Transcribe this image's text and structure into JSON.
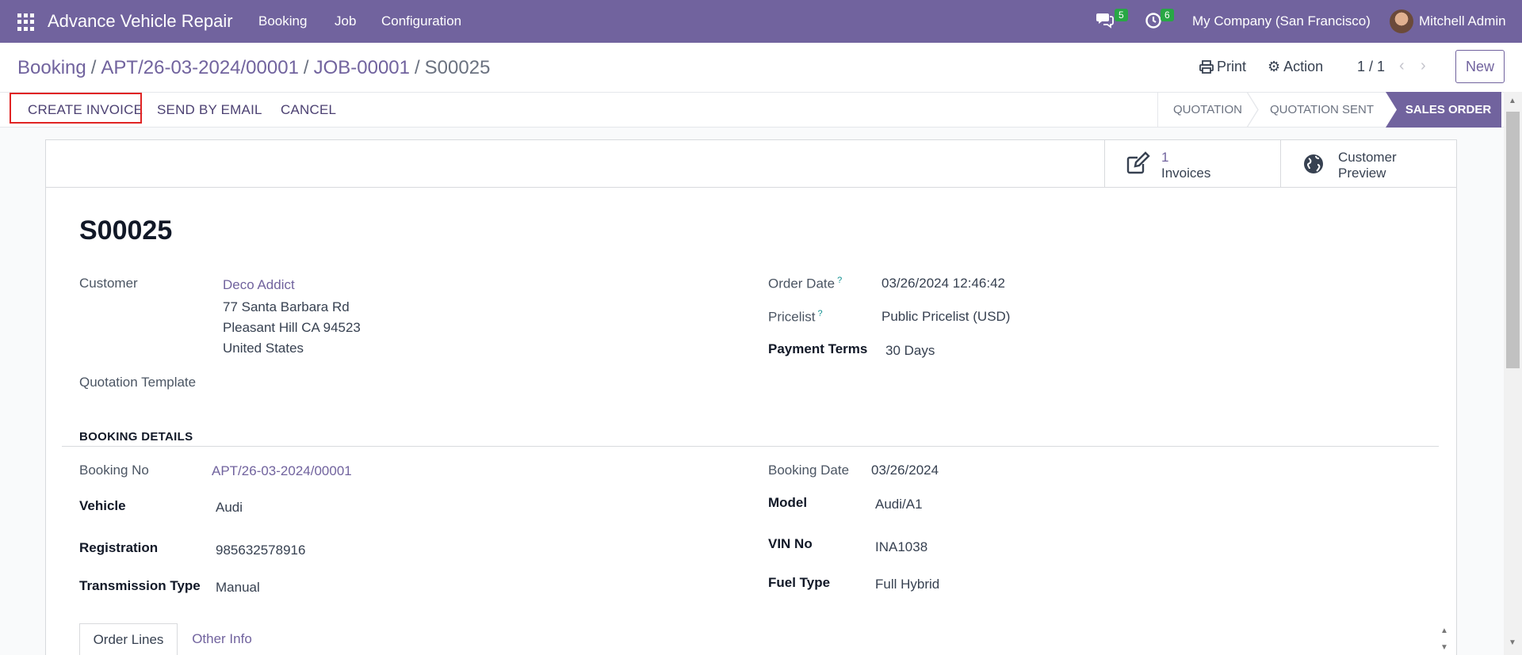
{
  "navbar": {
    "app_name": "Advance Vehicle Repair",
    "menu": [
      "Booking",
      "Job",
      "Configuration"
    ],
    "messages_count": "5",
    "activities_count": "6",
    "company": "My Company (San Francisco)",
    "user": "Mitchell Admin",
    "color": "#71639e"
  },
  "breadcrumb": {
    "items": [
      "Booking",
      "APT/26-03-2024/00001",
      "JOB-00001"
    ],
    "current": "S00025",
    "separator": "/"
  },
  "control_panel": {
    "print_label": "Print",
    "action_label": "Action",
    "pager": "1 / 1",
    "new_label": "New"
  },
  "status_bar": {
    "buttons": [
      "CREATE INVOICE",
      "SEND BY EMAIL",
      "CANCEL"
    ],
    "stages": [
      "QUOTATION",
      "QUOTATION SENT"
    ],
    "active_stage": "SALES ORDER"
  },
  "smart_buttons": {
    "invoices_count": "1",
    "invoices_label": "Invoices",
    "preview_line1": "Customer",
    "preview_line2": "Preview"
  },
  "record": {
    "title": "S00025",
    "customer_label": "Customer",
    "customer_name": "Deco Addict",
    "address_line1": "77 Santa Barbara Rd",
    "address_line2": "Pleasant Hill CA 94523",
    "address_line3": "United States",
    "quotation_template_label": "Quotation Template",
    "order_date_label": "Order Date",
    "order_date": "03/26/2024 12:46:42",
    "pricelist_label": "Pricelist",
    "pricelist": "Public Pricelist (USD)",
    "payment_terms_label": "Payment Terms",
    "payment_terms": "30 Days",
    "help_mark": "?"
  },
  "booking_details": {
    "section_title": "BOOKING DETAILS",
    "booking_no_label": "Booking No",
    "booking_no": "APT/26-03-2024/00001",
    "booking_date_label": "Booking Date",
    "booking_date": "03/26/2024",
    "vehicle_label": "Vehicle",
    "vehicle": "Audi",
    "model_label": "Model",
    "model": "Audi/A1",
    "registration_label": "Registration",
    "registration": "985632578916",
    "vin_label": "VIN No",
    "vin": "INA1038",
    "transmission_label": "Transmission Type",
    "transmission": "Manual",
    "fuel_label": "Fuel Type",
    "fuel": "Full Hybrid"
  },
  "tabs": [
    "Order Lines",
    "Other Info"
  ]
}
